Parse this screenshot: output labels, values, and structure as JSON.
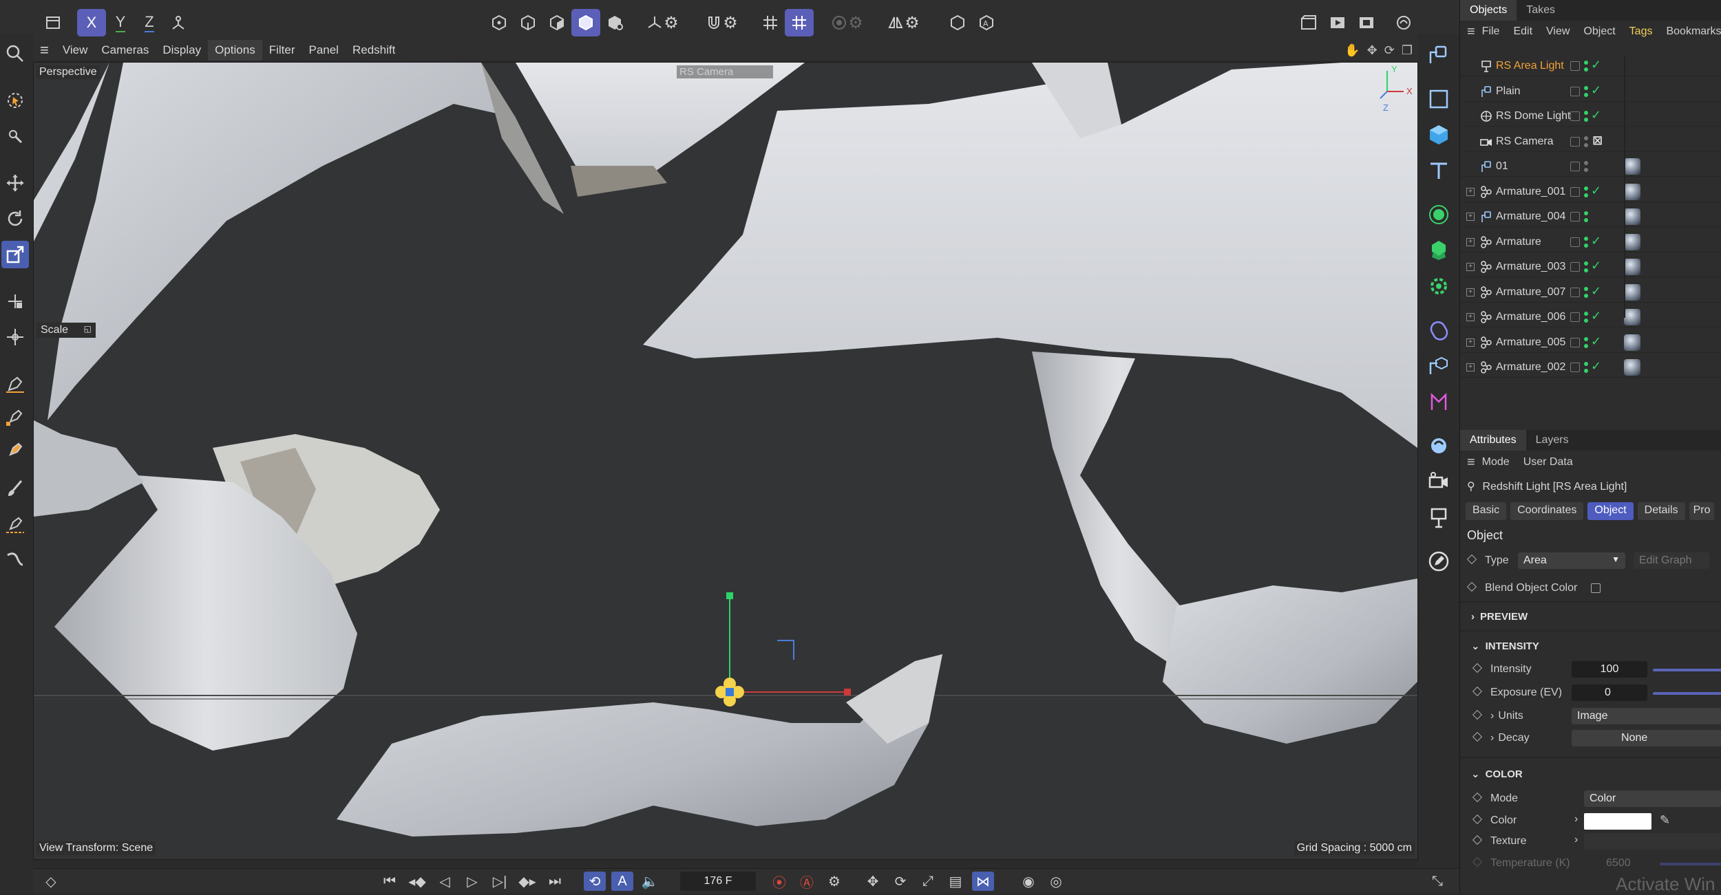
{
  "toolbar": {
    "axis_x": "X",
    "axis_y": "Y",
    "axis_z": "Z"
  },
  "viewport_menu": [
    "View",
    "Cameras",
    "Display",
    "Options",
    "Filter",
    "Panel",
    "Redshift"
  ],
  "viewport": {
    "mode": "Perspective",
    "camera": "RS Camera",
    "scale_label": "Scale",
    "view_transform": "View Transform: Scene",
    "grid_spacing": "Grid Spacing : 5000 cm",
    "axis_labels": {
      "x": "X",
      "y": "Y",
      "z": "Z"
    }
  },
  "timeline": {
    "frame": "176 F"
  },
  "objects_panel": {
    "tabs": [
      "Objects",
      "Takes"
    ],
    "menu": [
      "File",
      "Edit",
      "View",
      "Object",
      "Tags",
      "Bookmarks"
    ],
    "items": [
      {
        "name": "RS Area Light",
        "selected": true,
        "expandable": false,
        "icon": "light-icon",
        "tag": false,
        "checked": true
      },
      {
        "name": "Plain",
        "expandable": false,
        "icon": "null-icon",
        "tag": false,
        "checked": true
      },
      {
        "name": "RS Dome Light",
        "expandable": false,
        "icon": "dome-light-icon",
        "tag": false,
        "checked": true
      },
      {
        "name": "RS Camera",
        "expandable": false,
        "icon": "camera-icon",
        "tag": false,
        "checked": false
      },
      {
        "name": "01",
        "expandable": false,
        "icon": "null-icon",
        "tag": true,
        "checked": false
      },
      {
        "name": "Armature_001",
        "expandable": true,
        "icon": "armature-icon",
        "tag": true,
        "checked": true
      },
      {
        "name": "Armature_004",
        "expandable": true,
        "icon": "null-icon",
        "tag": true,
        "checked": false
      },
      {
        "name": "Armature",
        "expandable": true,
        "icon": "armature-icon",
        "tag": true,
        "checked": true
      },
      {
        "name": "Armature_003",
        "expandable": true,
        "icon": "armature-icon",
        "tag": true,
        "checked": true
      },
      {
        "name": "Armature_007",
        "expandable": true,
        "icon": "armature-icon",
        "tag": true,
        "checked": true
      },
      {
        "name": "Armature_006",
        "expandable": true,
        "icon": "armature-icon",
        "tag": true,
        "checked": true
      },
      {
        "name": "Armature_005",
        "expandable": true,
        "icon": "armature-icon",
        "tag": true,
        "checked": true
      },
      {
        "name": "Armature_002",
        "expandable": true,
        "icon": "armature-icon",
        "tag": true,
        "checked": true
      }
    ]
  },
  "attributes_panel": {
    "tabs": [
      "Attributes",
      "Layers"
    ],
    "menu": [
      "Mode",
      "User Data"
    ],
    "object_title": "Redshift Light [RS Area Light]",
    "sub_tabs": [
      "Basic",
      "Coordinates",
      "Object",
      "Details",
      "Pro"
    ],
    "active_sub_tab": "Object",
    "section_object": "Object",
    "type_label": "Type",
    "type_value": "Area",
    "edit_graph": "Edit Graph",
    "blend_label": "Blend Object Color",
    "preview": "PREVIEW",
    "intensity_section": "INTENSITY",
    "intensity_label": "Intensity",
    "intensity_value": "100",
    "exposure_label": "Exposure (EV)",
    "exposure_value": "0",
    "units_label": "Units",
    "units_value": "Image",
    "decay_label": "Decay",
    "decay_value": "None",
    "color_section": "COLOR",
    "mode_label": "Mode",
    "mode_value": "Color",
    "color_label": "Color",
    "texture_label": "Texture",
    "temperature_label": "Temperature (K)",
    "temperature_value": "6500",
    "watermark": "Activate Win"
  },
  "colors": {
    "accent": "#5b5fb8",
    "selected_object": "#f2a23a",
    "check_green": "#33d26a"
  }
}
